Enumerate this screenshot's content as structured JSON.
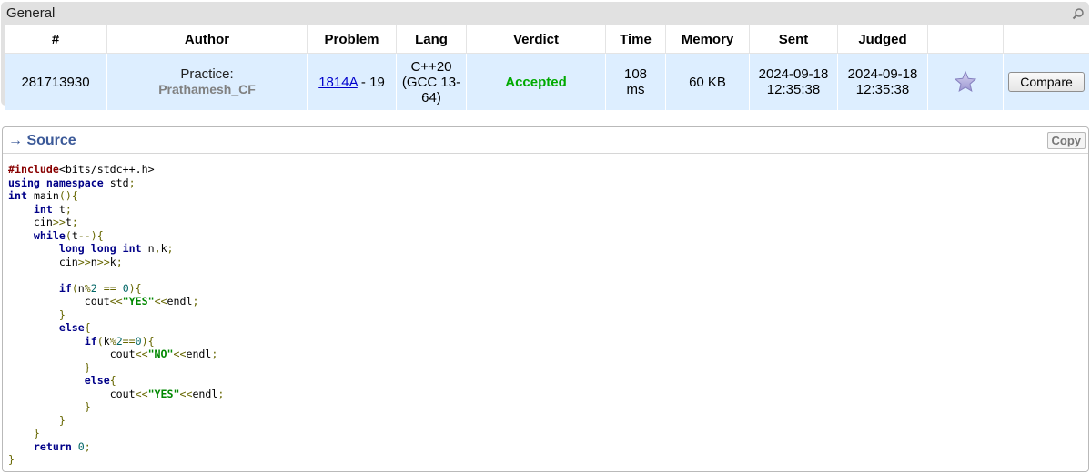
{
  "general": {
    "title": "General",
    "search_icon": "magnifier-icon",
    "columns": [
      "#",
      "Author",
      "Problem",
      "Lang",
      "Verdict",
      "Time",
      "Memory",
      "Sent",
      "Judged",
      "",
      ""
    ],
    "row": {
      "id": "281713930",
      "author_practice": "Practice:",
      "author_handle": "Prathamesh_CF",
      "problem_link": "1814A",
      "problem_suffix": " - 19",
      "lang_line1": "C++20",
      "lang_line2": "(GCC 13-",
      "lang_line3": "64)",
      "verdict": "Accepted",
      "time_value": "108",
      "time_unit": "ms",
      "memory": "60 KB",
      "sent_date": "2024-09-18",
      "sent_time": "12:35:38",
      "judged_date": "2024-09-18",
      "judged_time": "12:35:38",
      "favourite_icon": "star-icon",
      "compare_label": "Compare"
    },
    "colors": {
      "header_bg": "#e1e1e1",
      "row_bg": "#ddeeff",
      "verdict": "#00aa00",
      "link": "#0000cc",
      "handle": "#808080"
    }
  },
  "source": {
    "title": "→ Source",
    "copy_label": "Copy",
    "code_lines": [
      "#include<bits/stdc++.h>",
      "using namespace std;",
      "int main(){",
      "    int t;",
      "    cin>>t;",
      "    while(t--){",
      "        long long int n,k;",
      "        cin>>n>>k;",
      "",
      "        if(n%2 == 0){",
      "            cout<<\"YES\"<<endl;",
      "        }",
      "        else{",
      "            if(k%2==0){",
      "                cout<<\"NO\"<<endl;",
      "            }",
      "            else{",
      "                cout<<\"YES\"<<endl;",
      "            }",
      "        }",
      "    }",
      "    return 0;",
      "}"
    ],
    "colors": {
      "title": "#3b5998",
      "keyword": "#000088",
      "preprocessor": "#880000",
      "string": "#008800",
      "number": "#006666",
      "punctuation": "#666600"
    }
  }
}
